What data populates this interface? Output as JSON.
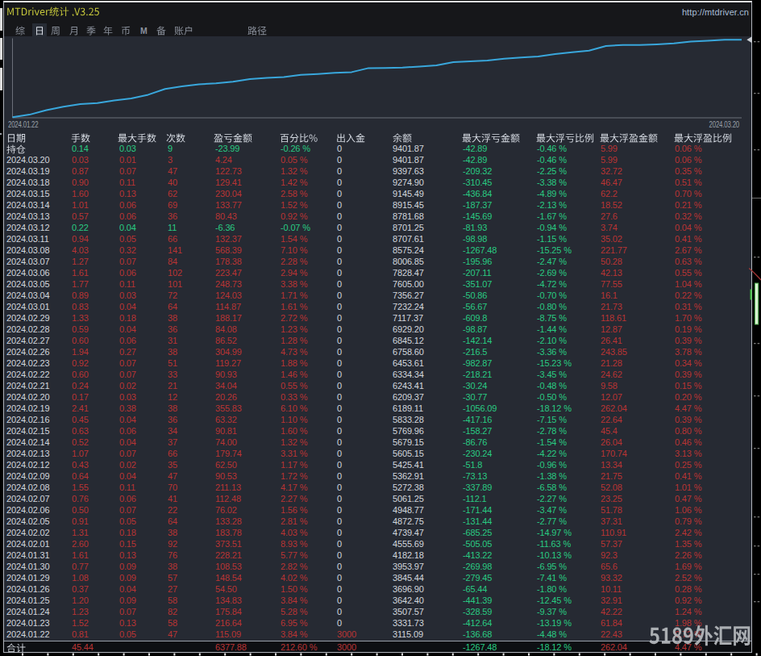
{
  "window": {
    "title": "MTDriver统计 ,V3.25",
    "url": "http://mtdriver.cn"
  },
  "menu": {
    "items": [
      {
        "label": "综",
        "selected": false
      },
      {
        "label": "日",
        "selected": true
      },
      {
        "label": "周",
        "selected": false
      },
      {
        "label": "月",
        "selected": false
      },
      {
        "label": "季",
        "selected": false
      },
      {
        "label": "年",
        "selected": false
      },
      {
        "label": "币",
        "selected": false
      },
      {
        "label": "M",
        "selected": false
      },
      {
        "label": "备",
        "selected": false
      },
      {
        "label": "账户",
        "selected": false
      },
      {
        "label": "路径",
        "selected": false
      }
    ]
  },
  "chart": {
    "start_label": "2024.01.22",
    "end_label": "2024.03.20"
  },
  "chart_data": {
    "type": "line",
    "series_name": "余额",
    "initial_balance": 3000,
    "x": [
      "2024.01.22",
      "2024.01.23",
      "2024.01.24",
      "2024.01.25",
      "2024.01.26",
      "2024.01.29",
      "2024.01.30",
      "2024.01.31",
      "2024.02.01",
      "2024.02.02",
      "2024.02.05",
      "2024.02.06",
      "2024.02.07",
      "2024.02.08",
      "2024.02.09",
      "2024.02.12",
      "2024.02.13",
      "2024.02.14",
      "2024.02.15",
      "2024.02.16",
      "2024.02.19",
      "2024.02.20",
      "2024.02.21",
      "2024.02.22",
      "2024.02.23",
      "2024.02.26",
      "2024.02.27",
      "2024.02.28",
      "2024.02.29",
      "2024.03.01",
      "2024.03.04",
      "2024.03.05",
      "2024.03.06",
      "2024.03.07",
      "2024.03.08",
      "2024.03.11",
      "2024.03.12",
      "2024.03.13",
      "2024.03.14",
      "2024.03.15",
      "2024.03.18",
      "2024.03.19",
      "2024.03.20"
    ],
    "values": [
      3115.09,
      3331.73,
      3507.57,
      3642.4,
      3696.9,
      3845.44,
      3953.97,
      4182.18,
      4555.69,
      4739.47,
      4872.75,
      4948.77,
      5061.25,
      5272.38,
      5362.91,
      5425.41,
      5605.15,
      5679.15,
      5769.96,
      5833.28,
      6189.11,
      6209.37,
      6243.41,
      6334.34,
      6453.61,
      6758.6,
      6845.12,
      6929.2,
      7117.37,
      7232.24,
      7356.27,
      7605.0,
      7828.47,
      8006.85,
      8575.24,
      8707.61,
      8701.25,
      8781.68,
      8915.45,
      9145.49,
      9274.9,
      9397.63,
      9401.87
    ],
    "trades_per_day": [
      47,
      58,
      82,
      58,
      27,
      57,
      38,
      76,
      92,
      38,
      64,
      22,
      41,
      70,
      47,
      35,
      66,
      37,
      34,
      36,
      38,
      12,
      21,
      33,
      51,
      38,
      31,
      36,
      38,
      64,
      72,
      101,
      102,
      84,
      141,
      66,
      11,
      36,
      69,
      62,
      40,
      47,
      3
    ],
    "ylim": [
      3000,
      9500
    ],
    "y_scale": "log",
    "line_color": "#39a7dc",
    "grid": false,
    "legend": "none"
  },
  "table": {
    "columns": [
      "日期",
      "手数",
      "最大手数",
      "次数",
      "盈亏金额",
      "百分比%",
      "出入金",
      "余额",
      "最大浮亏金额",
      "最大浮亏比例",
      "最大浮盈金额",
      "最大浮盈比例"
    ],
    "rows": [
      [
        "持仓",
        "0.14",
        "0.03",
        "9",
        "-23.99",
        "-0.26 %",
        "0",
        "9401.87",
        "-42.89",
        "-0.46 %",
        "5.99",
        "0.06 %"
      ],
      [
        "2024.03.20",
        "0.03",
        "0.01",
        "3",
        "4.24",
        "0.05 %",
        "0",
        "9401.87",
        "-42.89",
        "-0.46 %",
        "5.99",
        "0.06 %"
      ],
      [
        "2024.03.19",
        "0.87",
        "0.07",
        "47",
        "122.73",
        "1.32 %",
        "0",
        "9397.63",
        "-209.32",
        "-2.25 %",
        "32.72",
        "0.35 %"
      ],
      [
        "2024.03.18",
        "0.90",
        "0.11",
        "40",
        "129.41",
        "1.42 %",
        "0",
        "9274.90",
        "-310.45",
        "-3.38 %",
        "46.47",
        "0.51 %"
      ],
      [
        "2024.03.15",
        "1.60",
        "0.13",
        "62",
        "230.04",
        "2.58 %",
        "0",
        "9145.49",
        "-436.84",
        "-4.89 %",
        "62.2",
        "0.70 %"
      ],
      [
        "2024.03.14",
        "1.01",
        "0.06",
        "69",
        "133.77",
        "1.52 %",
        "0",
        "8915.45",
        "-187.37",
        "-2.13 %",
        "18.52",
        "0.21 %"
      ],
      [
        "2024.03.13",
        "0.57",
        "0.06",
        "36",
        "80.43",
        "0.92 %",
        "0",
        "8781.68",
        "-145.69",
        "-1.67 %",
        "27.6",
        "0.32 %"
      ],
      [
        "2024.03.12",
        "0.22",
        "0.04",
        "11",
        "-6.36",
        "-0.07 %",
        "0",
        "8701.25",
        "-81.93",
        "-0.94 %",
        "3.74",
        "0.04 %"
      ],
      [
        "2024.03.11",
        "0.94",
        "0.05",
        "66",
        "132.37",
        "1.54 %",
        "0",
        "8707.61",
        "-98.98",
        "-1.15 %",
        "35.02",
        "0.41 %"
      ],
      [
        "2024.03.08",
        "4.03",
        "0.32",
        "141",
        "568.39",
        "7.10 %",
        "0",
        "8575.24",
        "-1267.48",
        "-15.25 %",
        "221.77",
        "2.67 %"
      ],
      [
        "2024.03.07",
        "1.27",
        "0.07",
        "84",
        "178.38",
        "2.28 %",
        "0",
        "8006.85",
        "-195.96",
        "-2.47 %",
        "50.28",
        "0.63 %"
      ],
      [
        "2024.03.06",
        "1.61",
        "0.06",
        "102",
        "223.47",
        "2.94 %",
        "0",
        "7828.47",
        "-207.11",
        "-2.69 %",
        "42.13",
        "0.55 %"
      ],
      [
        "2024.03.05",
        "1.77",
        "0.11",
        "101",
        "248.73",
        "3.38 %",
        "0",
        "7605.00",
        "-351.07",
        "-4.72 %",
        "77.55",
        "1.04 %"
      ],
      [
        "2024.03.04",
        "0.89",
        "0.03",
        "72",
        "124.03",
        "1.71 %",
        "0",
        "7356.27",
        "-50.86",
        "-0.70 %",
        "16.1",
        "0.22 %"
      ],
      [
        "2024.03.01",
        "0.83",
        "0.04",
        "64",
        "114.87",
        "1.61 %",
        "0",
        "7232.24",
        "-56.67",
        "-0.80 %",
        "21.73",
        "0.31 %"
      ],
      [
        "2024.02.29",
        "1.33",
        "0.18",
        "38",
        "188.17",
        "2.72 %",
        "0",
        "7117.37",
        "-609.8",
        "-8.75 %",
        "118.61",
        "1.70 %"
      ],
      [
        "2024.02.28",
        "0.59",
        "0.04",
        "36",
        "84.08",
        "1.23 %",
        "0",
        "6929.20",
        "-98.87",
        "-1.44 %",
        "12.87",
        "0.19 %"
      ],
      [
        "2024.02.27",
        "0.60",
        "0.06",
        "31",
        "86.52",
        "1.28 %",
        "0",
        "6845.12",
        "-142.14",
        "-2.10 %",
        "26.41",
        "0.39 %"
      ],
      [
        "2024.02.26",
        "1.94",
        "0.27",
        "38",
        "304.99",
        "4.73 %",
        "0",
        "6758.60",
        "-216.5",
        "-3.36 %",
        "243.85",
        "3.78 %"
      ],
      [
        "2024.02.23",
        "0.92",
        "0.07",
        "51",
        "119.27",
        "1.88 %",
        "0",
        "6453.61",
        "-982.87",
        "-15.23 %",
        "21.28",
        "0.34 %"
      ],
      [
        "2024.02.22",
        "0.60",
        "0.07",
        "33",
        "90.93",
        "1.46 %",
        "0",
        "6334.34",
        "-218.21",
        "-3.45 %",
        "24.62",
        "0.39 %"
      ],
      [
        "2024.02.21",
        "0.24",
        "0.02",
        "21",
        "34.04",
        "0.55 %",
        "0",
        "6243.41",
        "-30.24",
        "-0.48 %",
        "9.58",
        "0.15 %"
      ],
      [
        "2024.02.20",
        "0.17",
        "0.03",
        "12",
        "20.26",
        "0.33 %",
        "0",
        "6209.37",
        "-30.77",
        "-0.50 %",
        "12.07",
        "0.20 %"
      ],
      [
        "2024.02.19",
        "2.41",
        "0.38",
        "38",
        "355.83",
        "6.10 %",
        "0",
        "6189.11",
        "-1056.09",
        "-18.12 %",
        "262.04",
        "4.47 %"
      ],
      [
        "2024.02.16",
        "0.45",
        "0.04",
        "36",
        "63.32",
        "1.10 %",
        "0",
        "5833.28",
        "-417.16",
        "-7.15 %",
        "22.64",
        "0.39 %"
      ],
      [
        "2024.02.15",
        "0.63",
        "0.06",
        "34",
        "90.81",
        "1.60 %",
        "0",
        "5769.96",
        "-158.27",
        "-2.78 %",
        "45.4",
        "0.80 %"
      ],
      [
        "2024.02.14",
        "0.52",
        "0.04",
        "37",
        "74.00",
        "1.32 %",
        "0",
        "5679.15",
        "-86.76",
        "-1.54 %",
        "26.04",
        "0.46 %"
      ],
      [
        "2024.02.13",
        "1.07",
        "0.07",
        "66",
        "179.74",
        "3.31 %",
        "0",
        "5605.15",
        "-230.24",
        "-4.22 %",
        "170.74",
        "3.13 %"
      ],
      [
        "2024.02.12",
        "0.43",
        "0.02",
        "35",
        "62.50",
        "1.17 %",
        "0",
        "5425.41",
        "-51.8",
        "-0.96 %",
        "13.34",
        "0.25 %"
      ],
      [
        "2024.02.09",
        "0.64",
        "0.04",
        "47",
        "90.53",
        "1.72 %",
        "0",
        "5362.91",
        "-73.13",
        "-1.38 %",
        "21.75",
        "0.41 %"
      ],
      [
        "2024.02.08",
        "1.55",
        "0.11",
        "70",
        "211.13",
        "4.17 %",
        "0",
        "5272.38",
        "-337.89",
        "-6.58 %",
        "52.08",
        "1.01 %"
      ],
      [
        "2024.02.07",
        "0.76",
        "0.06",
        "41",
        "112.48",
        "2.27 %",
        "0",
        "5061.25",
        "-112.1",
        "-2.27 %",
        "23.25",
        "0.47 %"
      ],
      [
        "2024.02.06",
        "0.50",
        "0.07",
        "22",
        "76.02",
        "1.56 %",
        "0",
        "4948.77",
        "-171.44",
        "-3.47 %",
        "51.78",
        "1.06 %"
      ],
      [
        "2024.02.05",
        "0.91",
        "0.05",
        "64",
        "133.28",
        "2.81 %",
        "0",
        "4872.75",
        "-131.44",
        "-2.77 %",
        "37.31",
        "0.79 %"
      ],
      [
        "2024.02.02",
        "1.31",
        "0.18",
        "38",
        "183.78",
        "4.03 %",
        "0",
        "4739.47",
        "-685.25",
        "-14.97 %",
        "110.91",
        "2.42 %"
      ],
      [
        "2024.02.01",
        "2.60",
        "0.15",
        "92",
        "373.51",
        "8.93 %",
        "0",
        "4555.69",
        "-505.05",
        "-11.63 %",
        "57.37",
        "1.35 %"
      ],
      [
        "2024.01.31",
        "1.61",
        "0.13",
        "76",
        "228.21",
        "5.77 %",
        "0",
        "4182.18",
        "-413.22",
        "-10.13 %",
        "92.3",
        "2.26 %"
      ],
      [
        "2024.01.30",
        "0.77",
        "0.09",
        "38",
        "108.53",
        "2.82 %",
        "0",
        "3953.97",
        "-269.98",
        "-6.95 %",
        "65.6",
        "1.69 %"
      ],
      [
        "2024.01.29",
        "1.08",
        "0.09",
        "57",
        "148.54",
        "4.02 %",
        "0",
        "3845.44",
        "-279.45",
        "-7.41 %",
        "93.32",
        "2.52 %"
      ],
      [
        "2024.01.26",
        "0.37",
        "0.04",
        "27",
        "54.50",
        "1.50 %",
        "0",
        "3696.90",
        "-65.44",
        "-1.80 %",
        "10.11",
        "0.28 %"
      ],
      [
        "2024.01.25",
        "1.20",
        "0.09",
        "58",
        "134.83",
        "3.84 %",
        "0",
        "3642.40",
        "-441.39",
        "-12.45 %",
        "32.91",
        "0.92 %"
      ],
      [
        "2024.01.24",
        "1.23",
        "0.07",
        "82",
        "175.84",
        "5.28 %",
        "0",
        "3507.57",
        "-328.59",
        "-9.37 %",
        "42.22",
        "1.24 %"
      ],
      [
        "2024.01.23",
        "1.52",
        "0.13",
        "58",
        "216.64",
        "6.95 %",
        "0",
        "3331.73",
        "-412.64",
        "-13.19 %",
        "61.84",
        "1.98 %"
      ],
      [
        "2024.01.22",
        "0.81",
        "0.05",
        "47",
        "115.09",
        "3.84 %",
        "3000",
        "3115.09",
        "-136.68",
        "-4.48 %",
        "22.43",
        "0.72 %"
      ]
    ],
    "total_row": [
      "合计",
      "45.44",
      "",
      "",
      "6377.88",
      "212.60 %",
      "3000",
      "",
      "-1267.48",
      "-18.12 %",
      "262.04",
      "4.47 %"
    ]
  },
  "watermark": {
    "text": "5189外汇网"
  },
  "colors": {
    "gain": "#b23030",
    "loss": "#29cb82",
    "neutral": "#d2d6dd",
    "accent_line": "#39a7dc",
    "title": "#c8ca3c",
    "content_bg": "#262a33",
    "bar_bg": "#16171a"
  }
}
